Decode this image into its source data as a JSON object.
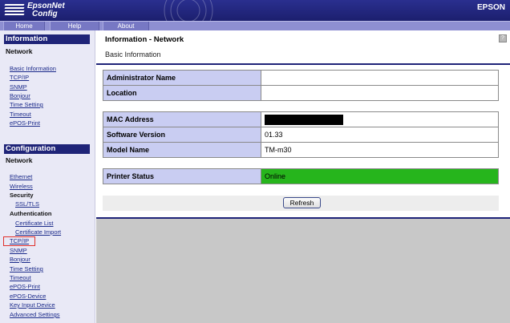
{
  "header": {
    "logo_line1": "EpsonNet",
    "logo_line2": "Config",
    "brand": "EPSON"
  },
  "menubar": {
    "items": [
      {
        "label": "Home"
      },
      {
        "label": "Help"
      },
      {
        "label": "About"
      }
    ]
  },
  "sidebar": {
    "information": {
      "title": "Information",
      "network_label": "Network",
      "links": [
        "Basic Information",
        "TCP/IP",
        "SNMP",
        "Bonjour",
        "Time Setting",
        "Timeout",
        "ePOS-Print"
      ]
    },
    "configuration": {
      "title": "Configuration",
      "network_label": "Network",
      "ethernet": "Ethernet",
      "wireless": "Wireless",
      "security": "Security",
      "ssl_tls": "SSL/TLS",
      "authentication": "Authentication",
      "certificate_list": "Certificate List",
      "certificate_import": "Certificate Import",
      "tcpip": "TCP/IP",
      "snmp": "SNMP",
      "bonjour": "Bonjour",
      "time_setting": "Time Setting",
      "timeout": "Timeout",
      "epos_print": "ePOS-Print",
      "epos_device": "ePOS-Device",
      "key_input_device": "Key Input Device",
      "advanced_settings": "Advanced Settings"
    }
  },
  "main": {
    "title": "Information - Network",
    "subtitle": "Basic Information",
    "help_icon": "?",
    "table1": [
      {
        "label": "Administrator Name",
        "value": ""
      },
      {
        "label": "Location",
        "value": ""
      }
    ],
    "table2": [
      {
        "label": "MAC Address",
        "value": ""
      },
      {
        "label": "Software Version",
        "value": "01.33"
      },
      {
        "label": "Model Name",
        "value": "TM-m30"
      }
    ],
    "status": {
      "label": "Printer Status",
      "value": "Online"
    },
    "refresh_label": "Refresh"
  },
  "colors": {
    "header_bg": "#1c1f6e",
    "section_title_bg": "#1f2478",
    "label_cell_bg": "#c9cdf2",
    "online_bg": "#26b51c",
    "highlight_box": "#e0302b"
  }
}
